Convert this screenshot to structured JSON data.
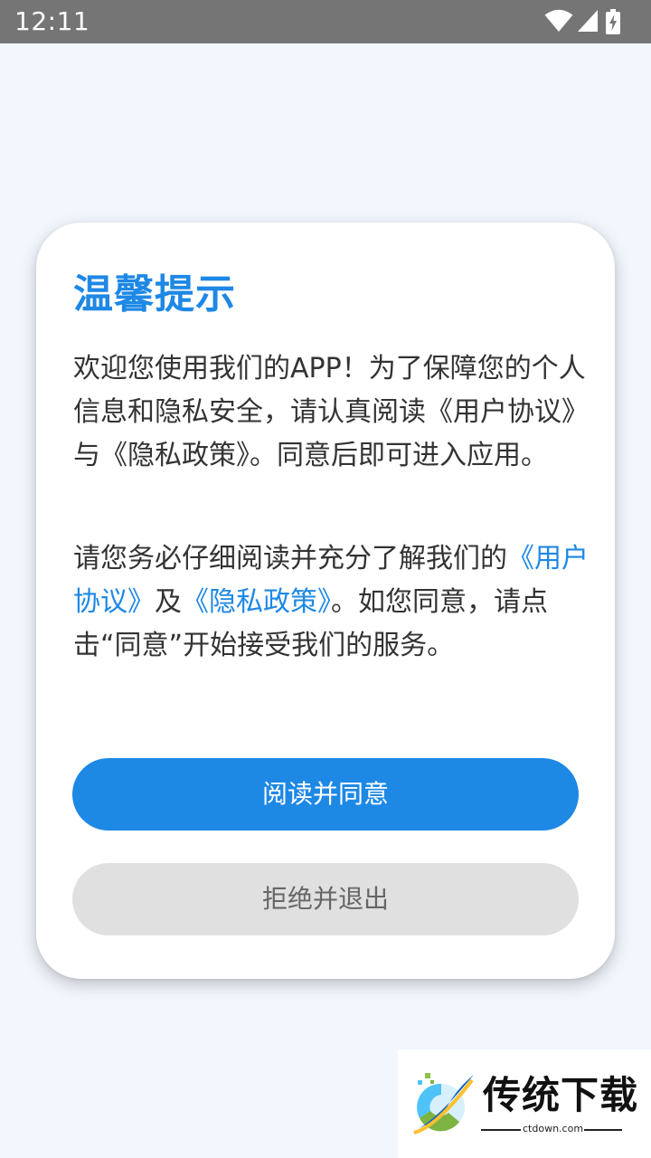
{
  "status_bar": {
    "time": "12:11",
    "icons": [
      "wifi-icon",
      "cellular-signal-icon",
      "battery-charging-icon"
    ],
    "background": "#757575"
  },
  "dialog": {
    "title": "温馨提示",
    "paragraph1": "欢迎您使用我们的APP！为了保障您的个人信息和隐私安全，请认真阅读《用户协议》与《隐私政策》。同意后即可进入应用。",
    "paragraph2": {
      "prefix": "请您务必仔细阅读并充分了解我们的",
      "user_agreement_link": "《用户协议》",
      "joiner": "及",
      "privacy_policy_link": "《隐私政策》",
      "suffix": "。如您同意，请点击“同意”开始接受我们的服务。"
    },
    "agree_button": "阅读并同意",
    "reject_button": "拒绝并退出"
  },
  "watermark": {
    "brand": "传统下载",
    "domain": "ctdown.com"
  },
  "colors": {
    "accent": "#1e88e5",
    "page_background": "#f2f6fd",
    "reject_button_bg": "#e0e0e0",
    "body_text": "#333333"
  }
}
